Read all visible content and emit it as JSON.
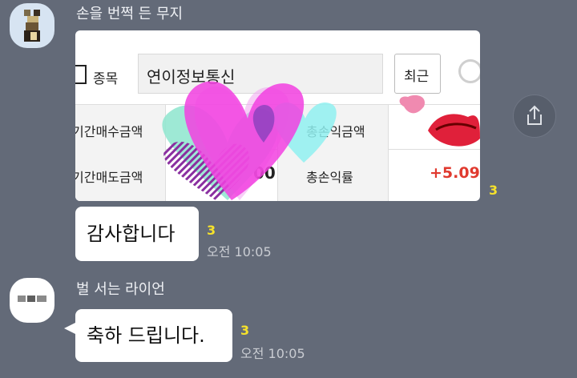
{
  "messages": [
    {
      "sender": "손을 번쩍 든 무지",
      "image": {
        "checkbox_label": "종목",
        "search_value": "연이정보통신",
        "recent_button": "최근",
        "rows": [
          {
            "left_label": "기간매수금액",
            "right_label": "총손익금액",
            "right_value": ""
          },
          {
            "left_label": "기간매도금액",
            "left_value": "00",
            "right_label": "총손익률",
            "right_value": "+5.09"
          }
        ]
      },
      "image_unread": "3"
    },
    {
      "text": "감사합니다",
      "unread": "3",
      "time": "오전 10:05"
    },
    {
      "sender": "벌 서는 라이언",
      "text": "축하 드립니다.",
      "unread": "3",
      "time": "오전 10:05"
    }
  ],
  "colors": {
    "background": "#636a78",
    "unread": "#f6e22b",
    "positive": "#e03a2f"
  }
}
